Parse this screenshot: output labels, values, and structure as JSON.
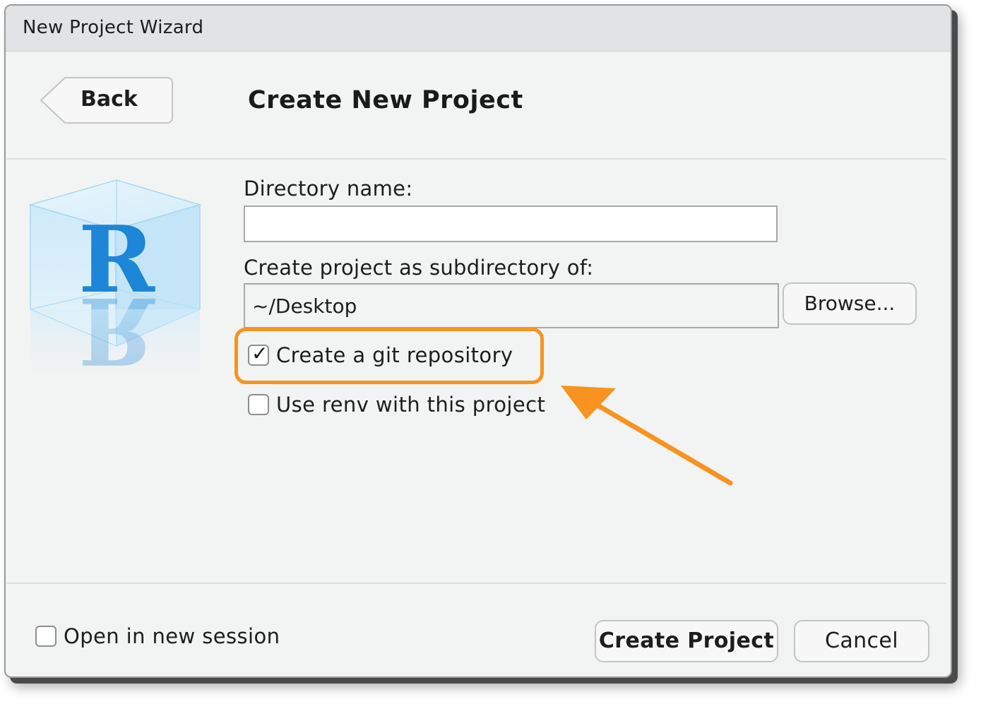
{
  "window": {
    "title": "New Project Wizard"
  },
  "header": {
    "back_label": "Back",
    "page_title": "Create New Project"
  },
  "form": {
    "directory_name": {
      "label": "Directory name:",
      "value": ""
    },
    "parent_directory": {
      "label": "Create project as subdirectory of:",
      "value": "~/Desktop",
      "browse_label": "Browse..."
    },
    "options": [
      {
        "label": "Create a git repository",
        "checked": true
      },
      {
        "label": "Use renv with this project",
        "checked": false
      }
    ]
  },
  "footer": {
    "open_new_session": {
      "label": "Open in new session",
      "checked": false
    },
    "create_label": "Create Project",
    "cancel_label": "Cancel"
  },
  "logo": {
    "letter": "R",
    "icon": "r-project-cube-icon"
  },
  "annotation": {
    "highlight_color": "#f7931e",
    "arrow_color": "#f7931e"
  },
  "colors": {
    "window_bg": "#f2f3f3",
    "titlebar_bg": "#e2e3e5",
    "logo_blue": "#1d86d6"
  }
}
